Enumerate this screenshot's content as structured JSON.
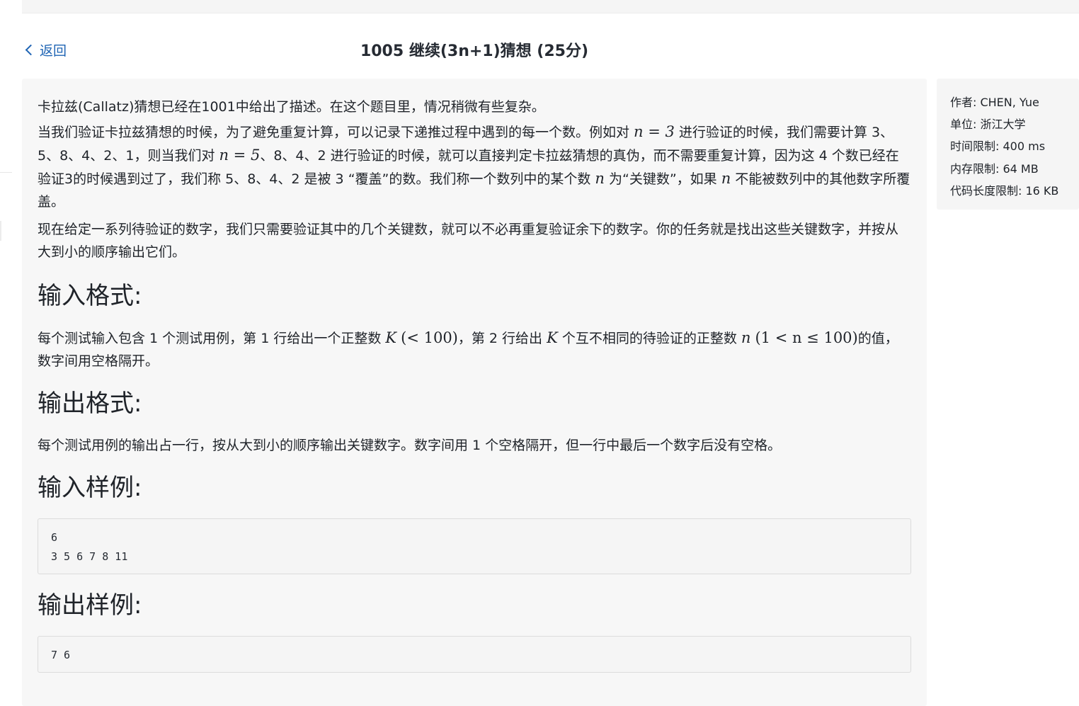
{
  "header": {
    "back_label": "返回",
    "title": "1005 继续(3n+1)猜想 (25分)"
  },
  "problem": {
    "intro": "卡拉兹(Callatz)猜想已经在1001中给出了描述。在这个题目里，情况稍微有些复杂。",
    "p2_a": "当我们验证卡拉兹猜想的时候，为了避免重复计算，可以记录下递推过程中遇到的每一个数。例如对 ",
    "p2_math1": "n = 3",
    "p2_b": " 进行验证的时候，我们需要计算 3、5、8、4、2、1，则当我们对 ",
    "p2_math2": "n = 5",
    "p2_c": "、8、4、2 进行验证的时候，就可以直接判定卡拉兹猜想的真伪，而不需要重复计算，因为这 4 个数已经在验证3的时候遇到过了，我们称 5、8、4、2 是被 3 “覆盖”的数。我们称一个数列中的某个数 ",
    "p2_math3": "n",
    "p2_d": " 为“关键数”，如果 ",
    "p2_math4": "n",
    "p2_e": " 不能被数列中的其他数字所覆盖。",
    "p3": "现在给定一系列待验证的数字，我们只需要验证其中的几个关键数，就可以不必再重复验证余下的数字。你的任务就是找出这些关键数字，并按从大到小的顺序输出它们。"
  },
  "input_section": {
    "heading": "输入格式:",
    "text_a": "每个测试输入包含 1 个测试用例，第 1 行给出一个正整数 ",
    "math1": "K",
    "math2": "(< 100)",
    "text_b": "，第 2 行给出 ",
    "math3": "K",
    "text_c": " 个互不相同的待验证的正整数 ",
    "math4": "n",
    "math5": "(1 < n ≤ 100)",
    "text_d": "的值，数字间用空格隔开。"
  },
  "output_section": {
    "heading": "输出格式:",
    "text": "每个测试用例的输出占一行，按从大到小的顺序输出关键数字。数字间用 1 个空格隔开，但一行中最后一个数字后没有空格。"
  },
  "sample_input": {
    "heading": "输入样例:",
    "line1": "6",
    "line2": "3 5 6 7 8 11"
  },
  "sample_output": {
    "heading": "输出样例:",
    "line1": "7 6"
  },
  "info": {
    "author": "作者: CHEN, Yue",
    "unit": "单位: 浙江大学",
    "time_limit": "时间限制: 400 ms",
    "memory_limit": "内存限制: 64 MB",
    "code_limit": "代码长度限制: 16 KB"
  },
  "colors": {
    "link": "#1e64b4",
    "panel_bg": "#f7f7f7",
    "text": "#1f2329"
  }
}
